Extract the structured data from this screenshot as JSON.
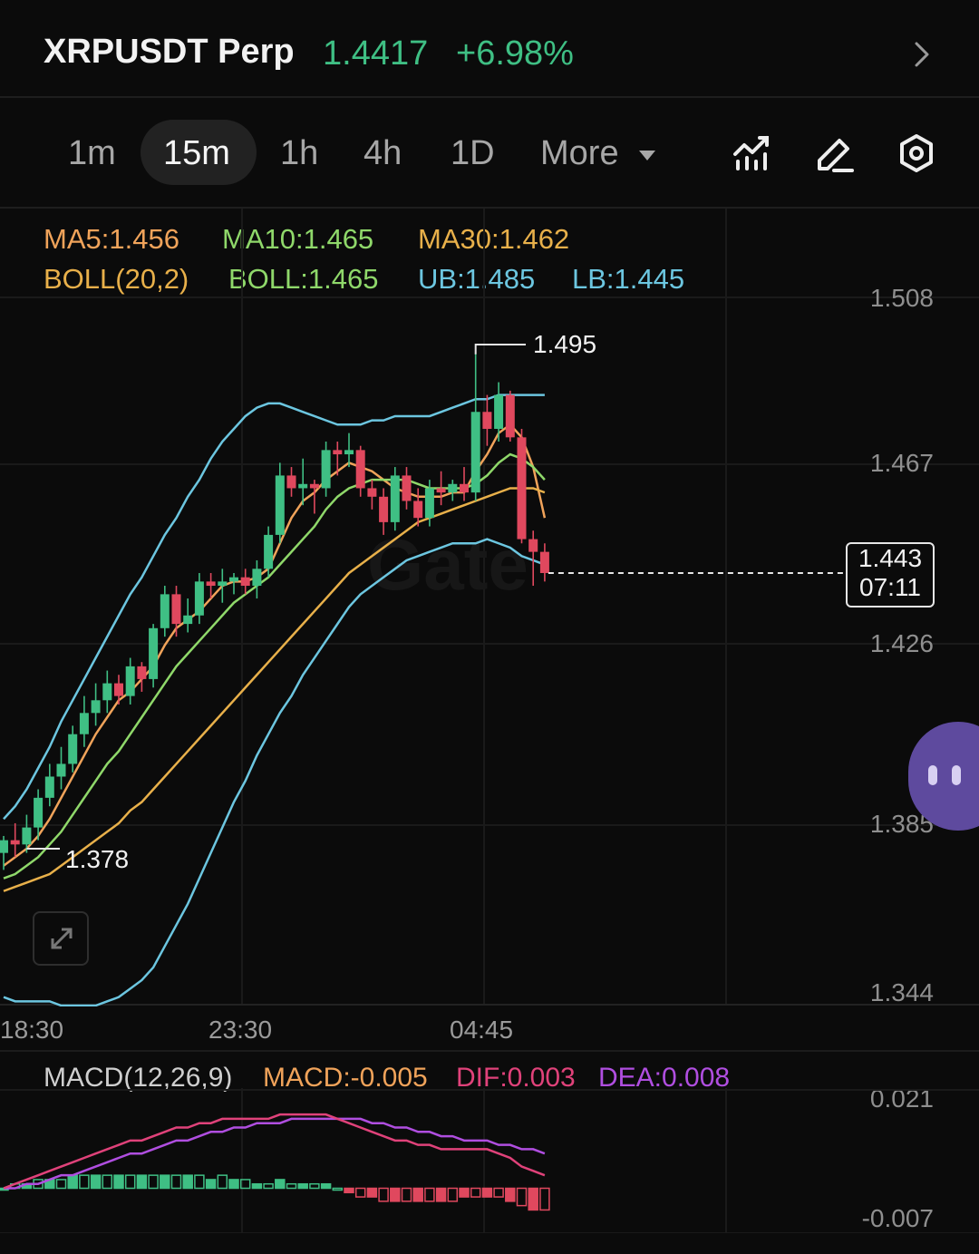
{
  "header": {
    "symbol": "XRPUSDT Perp",
    "price": "1.4417",
    "change": "+6.98%",
    "chevron_icon": "chevron-right-icon"
  },
  "tabs": [
    {
      "label": "1m",
      "active": false
    },
    {
      "label": "15m",
      "active": true
    },
    {
      "label": "1h",
      "active": false
    },
    {
      "label": "4h",
      "active": false
    },
    {
      "label": "1D",
      "active": false
    },
    {
      "label": "More",
      "active": false
    }
  ],
  "toolbar_icons": [
    "indicator-icon",
    "draw-pen-icon",
    "settings-hexagon-icon"
  ],
  "indicators": {
    "ma5": "MA5:1.456",
    "ma10": "MA10:1.465",
    "ma30": "MA30:1.462",
    "boll": "BOLL(20,2)",
    "boll_mid": "BOLL:1.465",
    "ub": "UB:1.485",
    "lb": "LB:1.445"
  },
  "y_axis": [
    "1.508",
    "1.467",
    "1.426",
    "1.385",
    "1.344"
  ],
  "x_axis": [
    "18:30",
    "23:30",
    "04:45"
  ],
  "annotations": {
    "high": "1.495",
    "low": "1.378"
  },
  "price_box": {
    "price": "1.443",
    "countdown": "07:11"
  },
  "watermark": "Gate",
  "macd": {
    "label": "MACD(12,26,9)",
    "macd": "MACD:-0.005",
    "dif": "DIF:0.003",
    "dea": "DEA:0.008",
    "y_axis": [
      "0.021",
      "-0.007"
    ]
  },
  "colors": {
    "up": "#3fbf84",
    "down": "#e0485e",
    "ma5": "#f0a35a",
    "ma10": "#8fd86a",
    "ma30": "#e8b04a",
    "boll_ub_lb": "#6cc6e0",
    "dif": "#e0427a",
    "dea": "#b04ee0"
  },
  "chart_data": {
    "type": "candlestick",
    "timeframe": "15m",
    "x_labels": [
      "18:30",
      "23:30",
      "04:45"
    ],
    "ylim": [
      1.344,
      1.508
    ],
    "candles": [
      {
        "o": 1.377,
        "h": 1.381,
        "l": 1.373,
        "c": 1.38
      },
      {
        "o": 1.38,
        "h": 1.384,
        "l": 1.376,
        "c": 1.379
      },
      {
        "o": 1.379,
        "h": 1.386,
        "l": 1.377,
        "c": 1.383
      },
      {
        "o": 1.383,
        "h": 1.392,
        "l": 1.38,
        "c": 1.39
      },
      {
        "o": 1.39,
        "h": 1.398,
        "l": 1.388,
        "c": 1.395
      },
      {
        "o": 1.395,
        "h": 1.402,
        "l": 1.392,
        "c": 1.398
      },
      {
        "o": 1.398,
        "h": 1.407,
        "l": 1.396,
        "c": 1.405
      },
      {
        "o": 1.405,
        "h": 1.414,
        "l": 1.402,
        "c": 1.41
      },
      {
        "o": 1.41,
        "h": 1.417,
        "l": 1.407,
        "c": 1.413
      },
      {
        "o": 1.413,
        "h": 1.42,
        "l": 1.41,
        "c": 1.417
      },
      {
        "o": 1.417,
        "h": 1.419,
        "l": 1.412,
        "c": 1.414
      },
      {
        "o": 1.414,
        "h": 1.423,
        "l": 1.412,
        "c": 1.421
      },
      {
        "o": 1.421,
        "h": 1.422,
        "l": 1.415,
        "c": 1.418
      },
      {
        "o": 1.418,
        "h": 1.431,
        "l": 1.416,
        "c": 1.43
      },
      {
        "o": 1.43,
        "h": 1.44,
        "l": 1.428,
        "c": 1.438
      },
      {
        "o": 1.438,
        "h": 1.44,
        "l": 1.428,
        "c": 1.431
      },
      {
        "o": 1.431,
        "h": 1.437,
        "l": 1.429,
        "c": 1.433
      },
      {
        "o": 1.433,
        "h": 1.443,
        "l": 1.431,
        "c": 1.441
      },
      {
        "o": 1.441,
        "h": 1.443,
        "l": 1.437,
        "c": 1.44
      },
      {
        "o": 1.44,
        "h": 1.444,
        "l": 1.436,
        "c": 1.441
      },
      {
        "o": 1.441,
        "h": 1.443,
        "l": 1.438,
        "c": 1.442
      },
      {
        "o": 1.442,
        "h": 1.444,
        "l": 1.438,
        "c": 1.44
      },
      {
        "o": 1.44,
        "h": 1.446,
        "l": 1.437,
        "c": 1.444
      },
      {
        "o": 1.444,
        "h": 1.454,
        "l": 1.442,
        "c": 1.452
      },
      {
        "o": 1.452,
        "h": 1.469,
        "l": 1.45,
        "c": 1.466
      },
      {
        "o": 1.466,
        "h": 1.468,
        "l": 1.461,
        "c": 1.463
      },
      {
        "o": 1.463,
        "h": 1.47,
        "l": 1.459,
        "c": 1.464
      },
      {
        "o": 1.464,
        "h": 1.465,
        "l": 1.457,
        "c": 1.463
      },
      {
        "o": 1.463,
        "h": 1.474,
        "l": 1.461,
        "c": 1.472
      },
      {
        "o": 1.472,
        "h": 1.474,
        "l": 1.466,
        "c": 1.471
      },
      {
        "o": 1.471,
        "h": 1.476,
        "l": 1.468,
        "c": 1.472
      },
      {
        "o": 1.472,
        "h": 1.473,
        "l": 1.461,
        "c": 1.463
      },
      {
        "o": 1.463,
        "h": 1.465,
        "l": 1.458,
        "c": 1.461
      },
      {
        "o": 1.461,
        "h": 1.463,
        "l": 1.452,
        "c": 1.455
      },
      {
        "o": 1.455,
        "h": 1.468,
        "l": 1.453,
        "c": 1.466
      },
      {
        "o": 1.466,
        "h": 1.468,
        "l": 1.458,
        "c": 1.46
      },
      {
        "o": 1.46,
        "h": 1.463,
        "l": 1.454,
        "c": 1.456
      },
      {
        "o": 1.456,
        "h": 1.465,
        "l": 1.454,
        "c": 1.463
      },
      {
        "o": 1.463,
        "h": 1.467,
        "l": 1.459,
        "c": 1.462
      },
      {
        "o": 1.462,
        "h": 1.465,
        "l": 1.46,
        "c": 1.464
      },
      {
        "o": 1.464,
        "h": 1.468,
        "l": 1.46,
        "c": 1.462
      },
      {
        "o": 1.462,
        "h": 1.495,
        "l": 1.46,
        "c": 1.481
      },
      {
        "o": 1.481,
        "h": 1.485,
        "l": 1.473,
        "c": 1.477
      },
      {
        "o": 1.477,
        "h": 1.488,
        "l": 1.474,
        "c": 1.485
      },
      {
        "o": 1.485,
        "h": 1.486,
        "l": 1.474,
        "c": 1.475
      },
      {
        "o": 1.475,
        "h": 1.477,
        "l": 1.45,
        "c": 1.451
      },
      {
        "o": 1.451,
        "h": 1.453,
        "l": 1.44,
        "c": 1.448
      },
      {
        "o": 1.448,
        "h": 1.45,
        "l": 1.441,
        "c": 1.443
      }
    ],
    "series": [
      {
        "name": "MA5",
        "values": [
          1.374,
          1.376,
          1.378,
          1.381,
          1.385,
          1.39,
          1.395,
          1.4,
          1.405,
          1.409,
          1.413,
          1.415,
          1.418,
          1.421,
          1.426,
          1.43,
          1.432,
          1.434,
          1.437,
          1.44,
          1.441,
          1.441,
          1.442,
          1.444,
          1.45,
          1.456,
          1.46,
          1.462,
          1.465,
          1.467,
          1.469,
          1.468,
          1.467,
          1.465,
          1.463,
          1.462,
          1.461,
          1.461,
          1.461,
          1.462,
          1.462,
          1.467,
          1.471,
          1.476,
          1.478,
          1.475,
          1.468,
          1.456
        ]
      },
      {
        "name": "MA10",
        "values": [
          1.371,
          1.372,
          1.374,
          1.376,
          1.379,
          1.382,
          1.386,
          1.39,
          1.394,
          1.398,
          1.401,
          1.405,
          1.409,
          1.413,
          1.417,
          1.421,
          1.424,
          1.427,
          1.43,
          1.433,
          1.436,
          1.438,
          1.44,
          1.442,
          1.445,
          1.448,
          1.451,
          1.454,
          1.458,
          1.461,
          1.463,
          1.464,
          1.465,
          1.465,
          1.465,
          1.465,
          1.464,
          1.463,
          1.463,
          1.463,
          1.463,
          1.464,
          1.466,
          1.469,
          1.471,
          1.47,
          1.468,
          1.465
        ]
      },
      {
        "name": "MA30",
        "values": [
          1.368,
          1.369,
          1.37,
          1.371,
          1.372,
          1.374,
          1.376,
          1.378,
          1.38,
          1.382,
          1.384,
          1.387,
          1.389,
          1.392,
          1.395,
          1.398,
          1.401,
          1.404,
          1.407,
          1.41,
          1.413,
          1.416,
          1.419,
          1.422,
          1.425,
          1.428,
          1.431,
          1.434,
          1.437,
          1.44,
          1.443,
          1.445,
          1.447,
          1.449,
          1.451,
          1.453,
          1.455,
          1.456,
          1.457,
          1.458,
          1.459,
          1.46,
          1.461,
          1.462,
          1.463,
          1.463,
          1.463,
          1.462
        ]
      },
      {
        "name": "UB",
        "values": [
          1.385,
          1.388,
          1.392,
          1.397,
          1.402,
          1.408,
          1.413,
          1.418,
          1.423,
          1.428,
          1.433,
          1.438,
          1.442,
          1.447,
          1.452,
          1.456,
          1.461,
          1.465,
          1.47,
          1.474,
          1.477,
          1.48,
          1.482,
          1.483,
          1.483,
          1.482,
          1.481,
          1.48,
          1.479,
          1.478,
          1.478,
          1.478,
          1.479,
          1.479,
          1.48,
          1.48,
          1.48,
          1.48,
          1.481,
          1.482,
          1.483,
          1.484,
          1.484,
          1.485,
          1.485,
          1.485,
          1.485,
          1.485
        ]
      },
      {
        "name": "LB",
        "values": [
          1.343,
          1.342,
          1.342,
          1.342,
          1.342,
          1.341,
          1.341,
          1.341,
          1.341,
          1.342,
          1.343,
          1.345,
          1.347,
          1.35,
          1.355,
          1.36,
          1.365,
          1.371,
          1.377,
          1.383,
          1.389,
          1.394,
          1.4,
          1.405,
          1.41,
          1.414,
          1.419,
          1.423,
          1.427,
          1.431,
          1.435,
          1.438,
          1.44,
          1.442,
          1.444,
          1.446,
          1.447,
          1.448,
          1.449,
          1.45,
          1.45,
          1.45,
          1.451,
          1.45,
          1.449,
          1.447,
          1.446,
          1.445
        ]
      }
    ],
    "macd": {
      "dif": [
        0.0,
        0.001,
        0.002,
        0.003,
        0.004,
        0.005,
        0.006,
        0.007,
        0.008,
        0.009,
        0.01,
        0.011,
        0.011,
        0.012,
        0.013,
        0.014,
        0.014,
        0.015,
        0.015,
        0.016,
        0.016,
        0.016,
        0.016,
        0.016,
        0.017,
        0.017,
        0.017,
        0.017,
        0.017,
        0.016,
        0.015,
        0.014,
        0.013,
        0.012,
        0.011,
        0.011,
        0.01,
        0.01,
        0.009,
        0.009,
        0.009,
        0.009,
        0.009,
        0.008,
        0.007,
        0.005,
        0.004,
        0.003
      ],
      "dea": [
        0.0,
        0.0,
        0.001,
        0.001,
        0.002,
        0.003,
        0.003,
        0.004,
        0.005,
        0.006,
        0.007,
        0.008,
        0.008,
        0.009,
        0.01,
        0.011,
        0.011,
        0.012,
        0.013,
        0.013,
        0.014,
        0.014,
        0.015,
        0.015,
        0.015,
        0.016,
        0.016,
        0.016,
        0.016,
        0.016,
        0.016,
        0.016,
        0.015,
        0.015,
        0.014,
        0.014,
        0.013,
        0.013,
        0.012,
        0.012,
        0.011,
        0.011,
        0.011,
        0.01,
        0.01,
        0.009,
        0.009,
        0.008
      ],
      "hist": [
        0.0,
        0.001,
        0.001,
        0.002,
        0.002,
        0.002,
        0.003,
        0.003,
        0.003,
        0.003,
        0.003,
        0.003,
        0.003,
        0.003,
        0.003,
        0.003,
        0.003,
        0.003,
        0.002,
        0.003,
        0.002,
        0.002,
        0.001,
        0.001,
        0.002,
        0.001,
        0.001,
        0.001,
        0.001,
        0.0,
        -0.001,
        -0.002,
        -0.002,
        -0.003,
        -0.003,
        -0.003,
        -0.003,
        -0.003,
        -0.003,
        -0.003,
        -0.002,
        -0.002,
        -0.002,
        -0.002,
        -0.003,
        -0.004,
        -0.005,
        -0.005
      ],
      "ylim": [
        -0.007,
        0.021
      ]
    }
  }
}
